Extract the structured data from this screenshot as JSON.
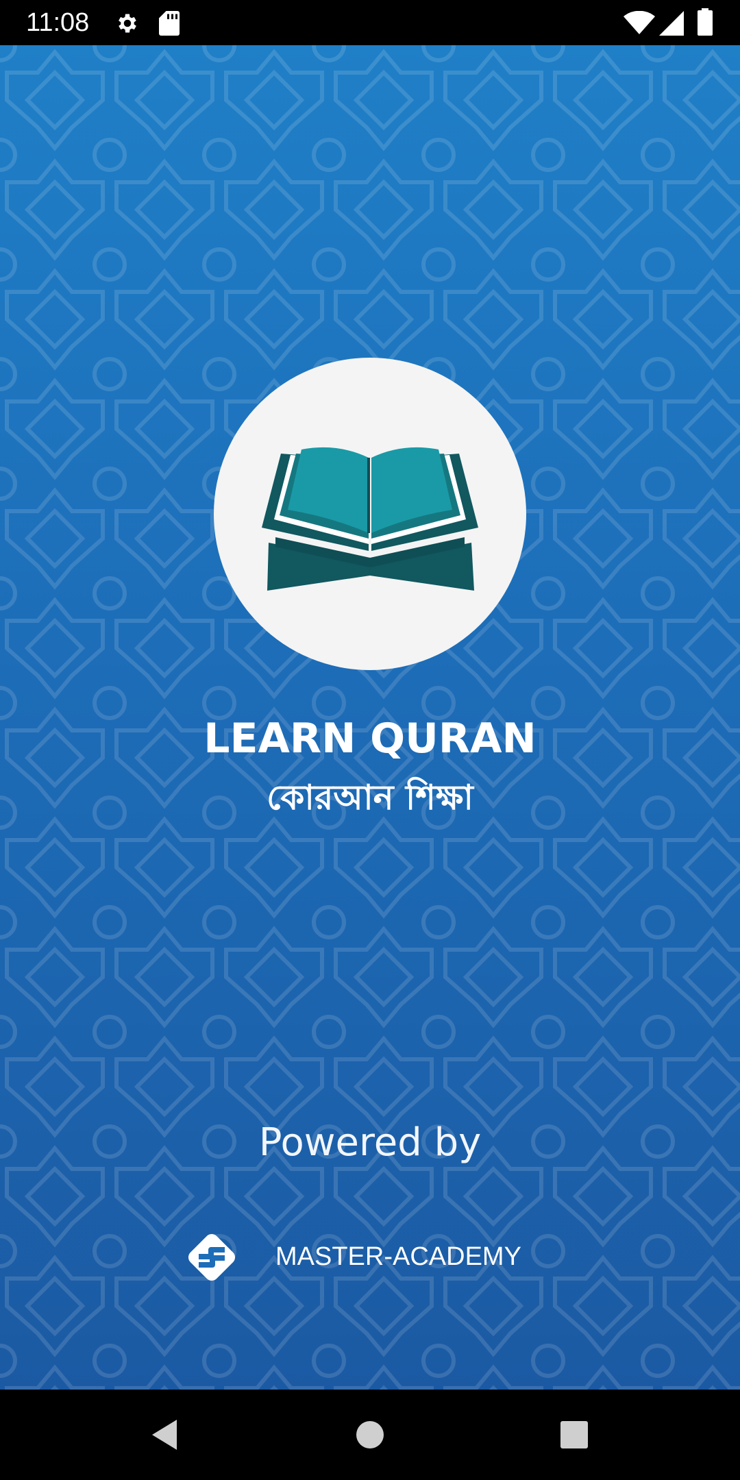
{
  "status_bar": {
    "time": "11:08",
    "icons": [
      "settings-gear-icon",
      "sd-card-icon",
      "wifi-icon",
      "cell-signal-icon",
      "battery-icon"
    ]
  },
  "app": {
    "title": "LEARN QURAN",
    "subtitle": "কোরআন শিক্ষা",
    "logo_icon": "open-quran-book-icon",
    "powered_by_label": "Powered by",
    "brand_name": "MASTER-ACADEMY",
    "brand_logo_icon": "master-academy-logo-icon"
  },
  "colors": {
    "background_top": "#1f7fc7",
    "background_bottom": "#1b5aa3",
    "logo_circle": "#f4f4f4",
    "book_teal": "#1a9aa6",
    "book_dark": "#11585f"
  },
  "nav_bar": {
    "buttons": [
      "back-icon",
      "home-icon",
      "recents-icon"
    ]
  }
}
